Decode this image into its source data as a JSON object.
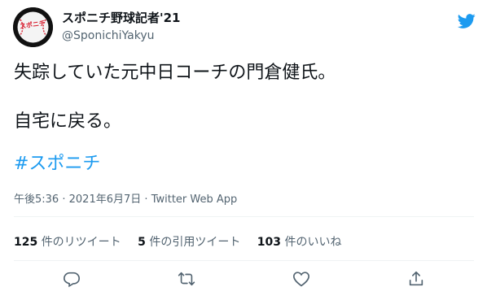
{
  "account": {
    "display_name": "スポニチ野球記者'21",
    "handle": "@SponichiYakyu",
    "avatar_text": "スポニチ"
  },
  "tweet": {
    "line1": "失踪していた元中日コーチの門倉健氏。",
    "line2": "自宅に戻る。",
    "hashtag": "#スポニチ",
    "time": "午後5:36",
    "separator": "·",
    "date": "2021年6月7日",
    "source": "Twitter Web App"
  },
  "stats": {
    "retweets_count": "125",
    "retweets_label": "件のリツイート",
    "quotes_count": "5",
    "quotes_label": "件の引用ツイート",
    "likes_count": "103",
    "likes_label": "件のいいね"
  },
  "icons": {
    "more": "twitter-logo-icon",
    "reply": "reply-icon",
    "retweet": "retweet-icon",
    "like": "heart-icon",
    "share": "share-icon"
  },
  "colors": {
    "text": "#0f1419",
    "secondary": "#536471",
    "link": "#1d9bf0",
    "divider": "#eff3f4",
    "avatar_red": "#d7182a"
  }
}
